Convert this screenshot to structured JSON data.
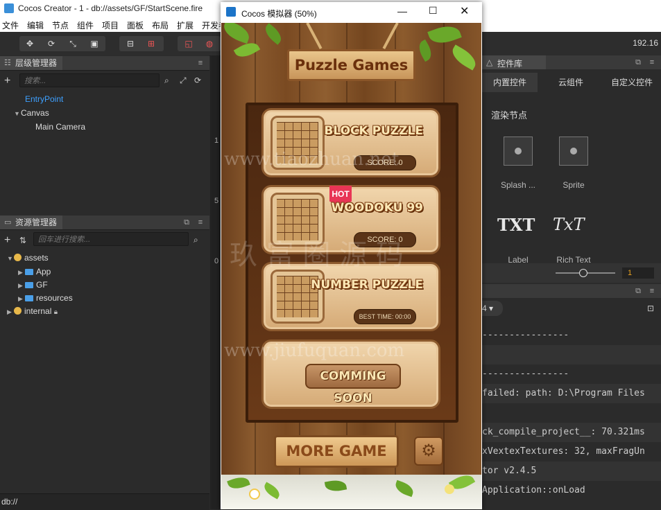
{
  "window": {
    "title": "Cocos Creator - 1 - db://assets/GF/StartScene.fire"
  },
  "menu": [
    "文件",
    "编辑",
    "节点",
    "组件",
    "项目",
    "面板",
    "布局",
    "扩展",
    "开发者"
  ],
  "toolbar": {
    "ip": "192.16"
  },
  "hierarchy": {
    "tab": "层级管理器",
    "search_placeholder": "搜索...",
    "items": [
      "EntryPoint",
      "Canvas",
      "Main Camera"
    ]
  },
  "assets": {
    "tab": "资源管理器",
    "search_placeholder": "回车进行搜索...",
    "items": [
      "assets",
      "App",
      "GF",
      "resources",
      "internal"
    ]
  },
  "status": {
    "path": "db://"
  },
  "simulator": {
    "title": "Cocos 模拟器 (50%)",
    "game": {
      "sign": "Puzzle Games",
      "cards": [
        {
          "title": "BLOCK PUZZLE",
          "score": "SCORE: 0"
        },
        {
          "title": "WOODOKU 99",
          "score": "SCORE: 0",
          "badge": "HOT"
        },
        {
          "title": "NUMBER PUZZLE",
          "score": "BEST TIME: 00:00"
        }
      ],
      "coming_soon": "COMMING SOON",
      "more_game": "MORE GAME",
      "watermarks": [
        "www.tiaozhuan.net",
        "玖 富 圈 源 码",
        "www.jiufuquan.com"
      ]
    }
  },
  "widgets": {
    "tab": "控件库",
    "subtabs": [
      "内置控件",
      "云组件",
      "自定义控件"
    ],
    "section": "渲染节点",
    "items": [
      {
        "label": "Splash ...",
        "icon": "image-icon"
      },
      {
        "label": "Sprite",
        "icon": "image-icon"
      },
      {
        "label": "Label",
        "glyph": "TXT"
      },
      {
        "label": "Rich Text",
        "glyph": "TxT"
      }
    ],
    "slider_value": "1"
  },
  "console": {
    "dropdown": "4 ▾",
    "lines": [
      "----------------",
      "",
      "----------------",
      "failed: path: D:\\Program Files",
      "",
      "ck_compile_project__: 70.321ms",
      "xVextexTextures: 32, maxFragUn",
      "tor v2.4.5",
      " Application::onLoad"
    ]
  },
  "side_numbers": [
    "1",
    "5",
    "0"
  ]
}
